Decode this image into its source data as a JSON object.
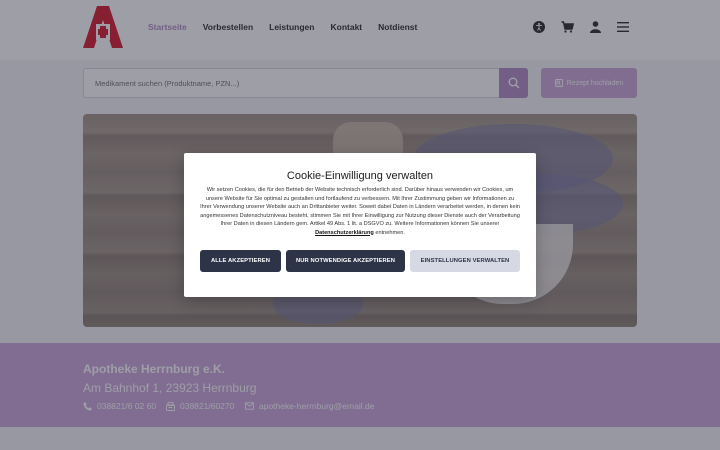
{
  "header": {
    "nav": [
      "Startseite",
      "Vorbestellen",
      "Leistungen",
      "Kontakt",
      "Notdienst"
    ],
    "active_index": 0,
    "icons": [
      "accessibility-icon",
      "cart-icon",
      "user-icon",
      "menu-icon"
    ]
  },
  "search": {
    "placeholder": "Medikament suchen (Produktname, PZN...)"
  },
  "rx_button": {
    "label": "Rezept hochladen"
  },
  "footer": {
    "name": "Apotheke Herrnburg e.K.",
    "address": "Am Bahnhof 1, 23923 Herrnburg",
    "phone": "038821/6 02 60",
    "fax": "038821/60270",
    "email": "apotheke-herrnburg@email.de"
  },
  "cookie": {
    "title": "Cookie-Einwilligung verwalten",
    "text_before": "Wir setzen Cookies, die für den Betrieb der Website technisch erforderlich sind. Darüber hinaus verwenden wir Cookies, um unsere Website für Sie optimal zu gestalten und fortlaufend zu verbessern. Mit Ihrer Zustimmung geben wir Informationen zu Ihrer Verwendung unserer Website auch an Drittanbieter weiter. Soweit dabei Daten in Ländern verarbeitet werden, in denen kein angemessenes Datenschutzniveau besteht, stimmen Sie mit Ihrer Einwilligung zur Nutzung dieser Dienste auch der Verarbeitung Ihrer Daten in diesen Ländern gem. Artikel 49 Abs. 1 lit. a DSGVO zu. Weitere Informationen können Sie unserer ",
    "link": "Datenschutzerklärung",
    "text_after": " entnehmen.",
    "buttons": {
      "accept_all": "ALLE AKZEPTIEREN",
      "accept_necessary": "NUR NOTWENDIGE AKZEPTIEREN",
      "settings": "EINSTELLUNGEN VERWALTEN"
    }
  },
  "colors": {
    "accent": "#b18cc2",
    "logo_red": "#d3192b",
    "button_dark": "#2d3447",
    "button_light": "#d6d8e3"
  }
}
